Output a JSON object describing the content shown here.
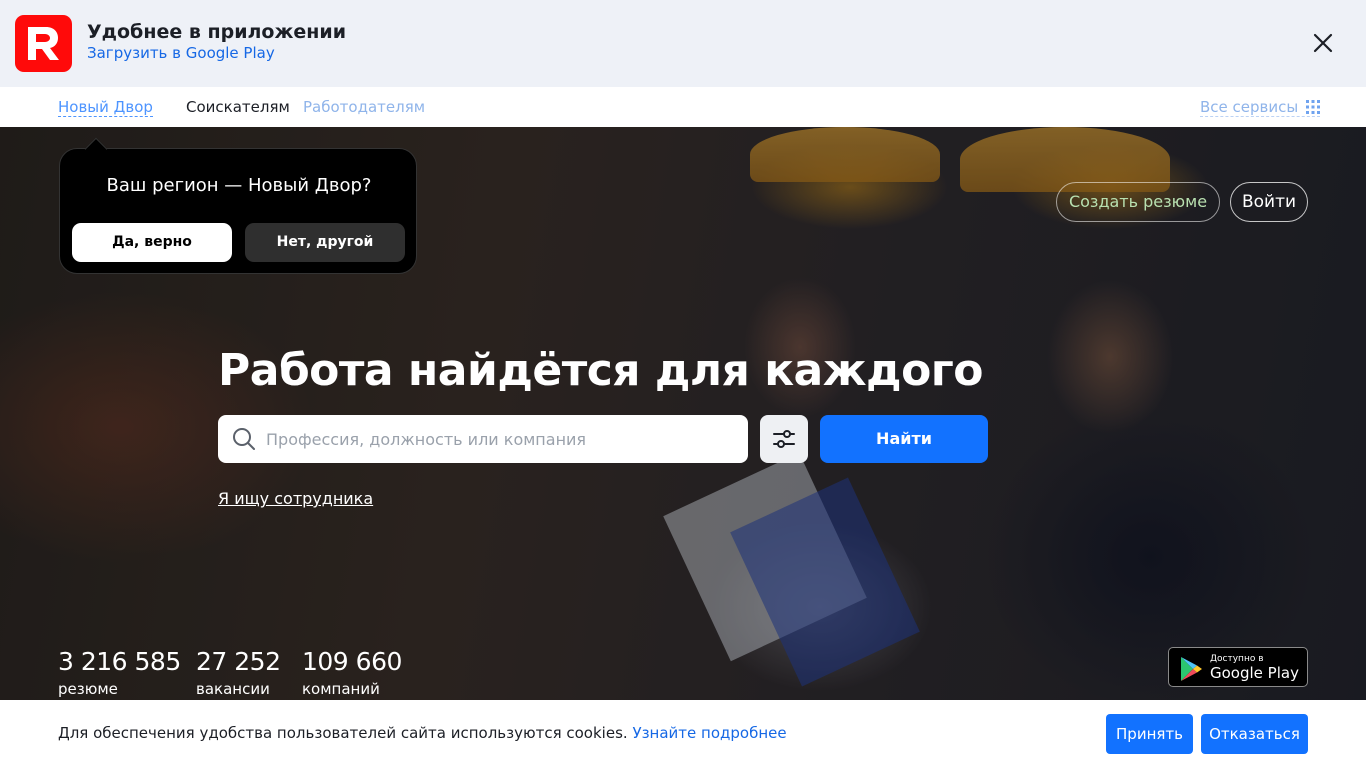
{
  "app_banner": {
    "title": "Удобнее в приложении",
    "subtitle": "Загрузить в Google Play",
    "logo_color": "#ff0a0a"
  },
  "nav": {
    "region": "Новый Двор",
    "seekers": "Соискателям",
    "employers": "Работодателям",
    "all_services": "Все сервисы"
  },
  "region_popup": {
    "question": "Ваш регион — Новый Двор?",
    "yes": "Да, верно",
    "no": "Нет, другой"
  },
  "header_actions": {
    "create_resume": "Создать резюме",
    "login": "Войти"
  },
  "hero": {
    "headline": "Работа найдётся для каждого",
    "search_placeholder": "Профессия, должность или компания",
    "search_value": "",
    "find_button": "Найти",
    "employer_link": "Я ищу сотрудника"
  },
  "stats": [
    {
      "value": "3 216 585",
      "label": "резюме"
    },
    {
      "value": "27 252",
      "label": "вакансии"
    },
    {
      "value": "109 660",
      "label": "компаний"
    }
  ],
  "google_play_badge": {
    "small": "Доступно в",
    "big": "Google Play"
  },
  "cookies": {
    "text": "Для обеспечения удобства пользователей сайта используются cookies.",
    "more": "Узнайте подробнее",
    "accept": "Принять",
    "decline": "Отказаться"
  },
  "colors": {
    "accent": "#1272ff",
    "link": "#1668e5"
  }
}
